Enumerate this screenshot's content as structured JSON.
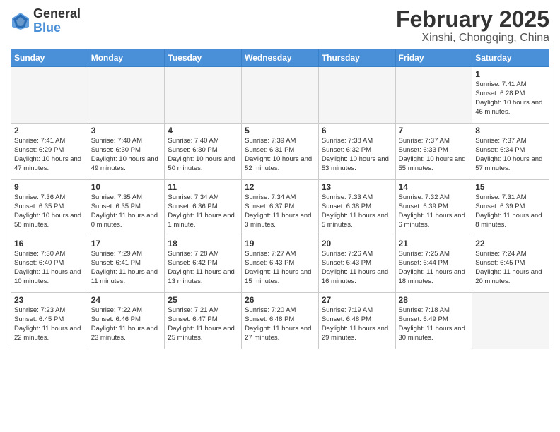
{
  "header": {
    "logo_general": "General",
    "logo_blue": "Blue",
    "title": "February 2025",
    "subtitle": "Xinshi, Chongqing, China"
  },
  "columns": [
    "Sunday",
    "Monday",
    "Tuesday",
    "Wednesday",
    "Thursday",
    "Friday",
    "Saturday"
  ],
  "weeks": [
    {
      "days": [
        {
          "num": "",
          "info": "",
          "empty": true
        },
        {
          "num": "",
          "info": "",
          "empty": true
        },
        {
          "num": "",
          "info": "",
          "empty": true
        },
        {
          "num": "",
          "info": "",
          "empty": true
        },
        {
          "num": "",
          "info": "",
          "empty": true
        },
        {
          "num": "",
          "info": "",
          "empty": true
        },
        {
          "num": "1",
          "info": "Sunrise: 7:41 AM\nSunset: 6:28 PM\nDaylight: 10 hours\nand 46 minutes.",
          "empty": false
        }
      ]
    },
    {
      "days": [
        {
          "num": "2",
          "info": "Sunrise: 7:41 AM\nSunset: 6:29 PM\nDaylight: 10 hours\nand 47 minutes.",
          "empty": false
        },
        {
          "num": "3",
          "info": "Sunrise: 7:40 AM\nSunset: 6:30 PM\nDaylight: 10 hours\nand 49 minutes.",
          "empty": false
        },
        {
          "num": "4",
          "info": "Sunrise: 7:40 AM\nSunset: 6:30 PM\nDaylight: 10 hours\nand 50 minutes.",
          "empty": false
        },
        {
          "num": "5",
          "info": "Sunrise: 7:39 AM\nSunset: 6:31 PM\nDaylight: 10 hours\nand 52 minutes.",
          "empty": false
        },
        {
          "num": "6",
          "info": "Sunrise: 7:38 AM\nSunset: 6:32 PM\nDaylight: 10 hours\nand 53 minutes.",
          "empty": false
        },
        {
          "num": "7",
          "info": "Sunrise: 7:37 AM\nSunset: 6:33 PM\nDaylight: 10 hours\nand 55 minutes.",
          "empty": false
        },
        {
          "num": "8",
          "info": "Sunrise: 7:37 AM\nSunset: 6:34 PM\nDaylight: 10 hours\nand 57 minutes.",
          "empty": false
        }
      ]
    },
    {
      "days": [
        {
          "num": "9",
          "info": "Sunrise: 7:36 AM\nSunset: 6:35 PM\nDaylight: 10 hours\nand 58 minutes.",
          "empty": false
        },
        {
          "num": "10",
          "info": "Sunrise: 7:35 AM\nSunset: 6:35 PM\nDaylight: 11 hours\nand 0 minutes.",
          "empty": false
        },
        {
          "num": "11",
          "info": "Sunrise: 7:34 AM\nSunset: 6:36 PM\nDaylight: 11 hours\nand 1 minute.",
          "empty": false
        },
        {
          "num": "12",
          "info": "Sunrise: 7:34 AM\nSunset: 6:37 PM\nDaylight: 11 hours\nand 3 minutes.",
          "empty": false
        },
        {
          "num": "13",
          "info": "Sunrise: 7:33 AM\nSunset: 6:38 PM\nDaylight: 11 hours\nand 5 minutes.",
          "empty": false
        },
        {
          "num": "14",
          "info": "Sunrise: 7:32 AM\nSunset: 6:39 PM\nDaylight: 11 hours\nand 6 minutes.",
          "empty": false
        },
        {
          "num": "15",
          "info": "Sunrise: 7:31 AM\nSunset: 6:39 PM\nDaylight: 11 hours\nand 8 minutes.",
          "empty": false
        }
      ]
    },
    {
      "days": [
        {
          "num": "16",
          "info": "Sunrise: 7:30 AM\nSunset: 6:40 PM\nDaylight: 11 hours\nand 10 minutes.",
          "empty": false
        },
        {
          "num": "17",
          "info": "Sunrise: 7:29 AM\nSunset: 6:41 PM\nDaylight: 11 hours\nand 11 minutes.",
          "empty": false
        },
        {
          "num": "18",
          "info": "Sunrise: 7:28 AM\nSunset: 6:42 PM\nDaylight: 11 hours\nand 13 minutes.",
          "empty": false
        },
        {
          "num": "19",
          "info": "Sunrise: 7:27 AM\nSunset: 6:43 PM\nDaylight: 11 hours\nand 15 minutes.",
          "empty": false
        },
        {
          "num": "20",
          "info": "Sunrise: 7:26 AM\nSunset: 6:43 PM\nDaylight: 11 hours\nand 16 minutes.",
          "empty": false
        },
        {
          "num": "21",
          "info": "Sunrise: 7:25 AM\nSunset: 6:44 PM\nDaylight: 11 hours\nand 18 minutes.",
          "empty": false
        },
        {
          "num": "22",
          "info": "Sunrise: 7:24 AM\nSunset: 6:45 PM\nDaylight: 11 hours\nand 20 minutes.",
          "empty": false
        }
      ]
    },
    {
      "days": [
        {
          "num": "23",
          "info": "Sunrise: 7:23 AM\nSunset: 6:45 PM\nDaylight: 11 hours\nand 22 minutes.",
          "empty": false
        },
        {
          "num": "24",
          "info": "Sunrise: 7:22 AM\nSunset: 6:46 PM\nDaylight: 11 hours\nand 23 minutes.",
          "empty": false
        },
        {
          "num": "25",
          "info": "Sunrise: 7:21 AM\nSunset: 6:47 PM\nDaylight: 11 hours\nand 25 minutes.",
          "empty": false
        },
        {
          "num": "26",
          "info": "Sunrise: 7:20 AM\nSunset: 6:48 PM\nDaylight: 11 hours\nand 27 minutes.",
          "empty": false
        },
        {
          "num": "27",
          "info": "Sunrise: 7:19 AM\nSunset: 6:48 PM\nDaylight: 11 hours\nand 29 minutes.",
          "empty": false
        },
        {
          "num": "28",
          "info": "Sunrise: 7:18 AM\nSunset: 6:49 PM\nDaylight: 11 hours\nand 30 minutes.",
          "empty": false
        },
        {
          "num": "",
          "info": "",
          "empty": true
        }
      ]
    }
  ]
}
